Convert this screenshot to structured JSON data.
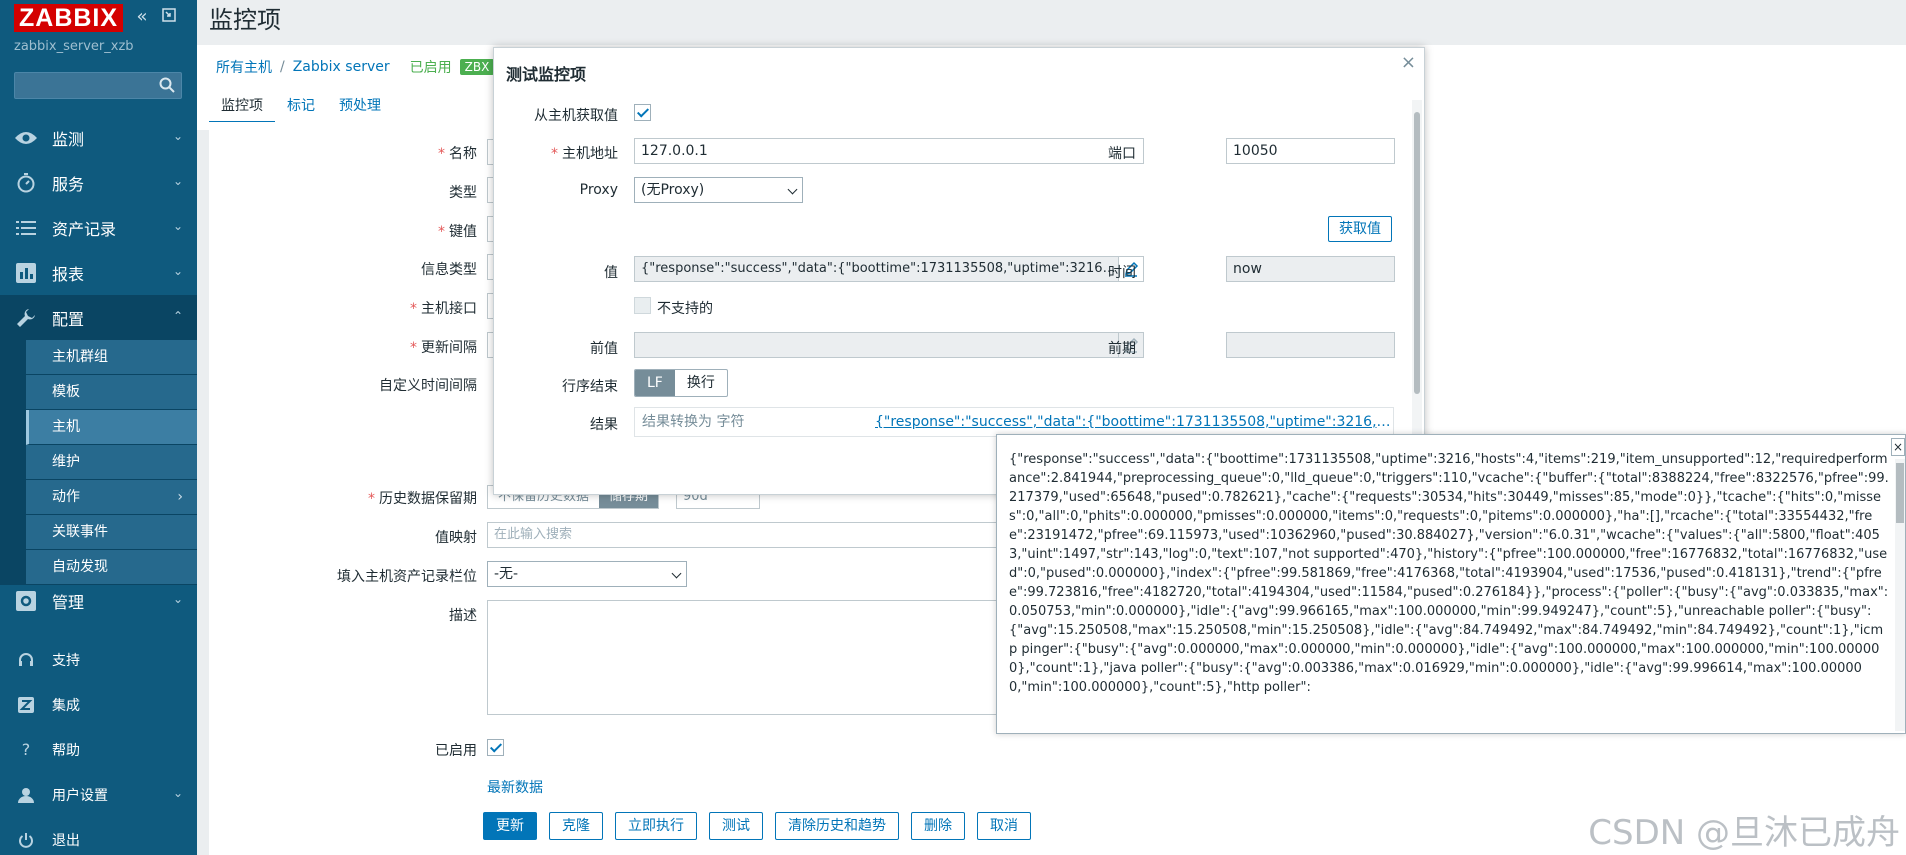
{
  "sidebar": {
    "logo": "ZABBIX",
    "server_name": "zabbix_server_xzb",
    "search_placeholder": "",
    "menu": [
      {
        "label": "监测"
      },
      {
        "label": "服务"
      },
      {
        "label": "资产记录"
      },
      {
        "label": "报表"
      },
      {
        "label": "配置"
      }
    ],
    "submenu": [
      {
        "label": "主机群组"
      },
      {
        "label": "模板"
      },
      {
        "label": "主机"
      },
      {
        "label": "维护"
      },
      {
        "label": "动作"
      },
      {
        "label": "关联事件"
      },
      {
        "label": "自动发现"
      }
    ],
    "admin": {
      "label": "管理"
    },
    "bottom": [
      {
        "label": "支持"
      },
      {
        "label": "集成"
      },
      {
        "label": "帮助"
      },
      {
        "label": "用户设置"
      },
      {
        "label": "退出"
      }
    ]
  },
  "page": {
    "title": "监控项",
    "breadcrumb": {
      "all_hosts": "所有主机",
      "sep": "/",
      "host": "Zabbix server",
      "status": "已启用",
      "badge": "ZBX"
    },
    "tabs": [
      {
        "label": "监控项"
      },
      {
        "label": "标记"
      },
      {
        "label": "预处理"
      }
    ]
  },
  "form": {
    "labels": {
      "name": "名称",
      "type": "类型",
      "key": "键值",
      "info_type": "信息类型",
      "interface": "主机接口",
      "interval": "更新间隔",
      "custom_interval": "自定义时间间隔",
      "history": "历史数据保留期",
      "valuemap": "值映射",
      "inventory": "填入主机资产记录栏位",
      "description": "描述",
      "enabled": "已启用"
    },
    "history": {
      "option1": "不保留历史数据",
      "option2": "储存期",
      "value": "90d"
    },
    "valuemap_placeholder": "在此输入搜索",
    "inventory_value": "-无-",
    "latest_data": "最新数据",
    "buttons": {
      "update": "更新",
      "clone": "克隆",
      "execute_now": "立即执行",
      "test": "测试",
      "clear": "清除历史和趋势",
      "delete": "删除",
      "cancel": "取消"
    }
  },
  "dialog": {
    "title": "测试监控项",
    "close": "×",
    "get_from_host_label": "从主机获取值",
    "host_address_label": "主机地址",
    "host_address": "127.0.0.1",
    "port_label": "端口",
    "port": "10050",
    "proxy_label": "Proxy",
    "proxy_value": "(无Proxy)",
    "get_value_button": "获取值",
    "value_label": "值",
    "value": "{\"response\":\"success\",\"data\":{\"boottime\":1731135508,\"uptime\":3216,\"hosts\":4,\"items\":219,",
    "time_label": "时间",
    "time_value": "now",
    "not_supported_label": "不支持的",
    "prev_value_label": "前值",
    "prev_time_label": "前期",
    "eol_label": "行序结束",
    "eol_lf": "LF",
    "eol_crlf": "换行",
    "result_label": "结果",
    "result_type": "结果转换为 字符",
    "result_value": "{\"response\":\"success\",\"data\":{\"boottime\":1731135508,\"uptime\":3216,\"hosts\":4,\"items\":219,"
  },
  "hintbox": {
    "close": "×",
    "text": "{\"response\":\"success\",\"data\":{\"boottime\":1731135508,\"uptime\":3216,\"hosts\":4,\"items\":219,\"item_unsupported\":12,\"requiredperformance\":2.841944,\"preprocessing_queue\":0,\"lld_queue\":0,\"triggers\":110,\"vcache\":{\"buffer\":{\"total\":8388224,\"free\":8322576,\"pfree\":99.217379,\"used\":65648,\"pused\":0.782621},\"cache\":{\"requests\":30534,\"hits\":30449,\"misses\":85,\"mode\":0}},\"tcache\":{\"hits\":0,\"misses\":0,\"all\":0,\"phits\":0.000000,\"pmisses\":0.000000,\"items\":0,\"requests\":0,\"pitems\":0.000000},\"ha\":[],\"rcache\":{\"total\":33554432,\"free\":23191472,\"pfree\":69.115973,\"used\":10362960,\"pused\":30.884027},\"version\":\"6.0.31\",\"wcache\":{\"values\":{\"all\":5800,\"float\":4053,\"uint\":1497,\"str\":143,\"log\":0,\"text\":107,\"not supported\":470},\"history\":{\"pfree\":100.000000,\"free\":16776832,\"total\":16776832,\"used\":0,\"pused\":0.000000},\"index\":{\"pfree\":99.581869,\"free\":4176368,\"total\":4193904,\"used\":17536,\"pused\":0.418131},\"trend\":{\"pfree\":99.723816,\"free\":4182720,\"total\":4194304,\"used\":11584,\"pused\":0.276184}},\"process\":{\"poller\":{\"busy\":{\"avg\":0.033835,\"max\":0.050753,\"min\":0.000000},\"idle\":{\"avg\":99.966165,\"max\":100.000000,\"min\":99.949247},\"count\":5},\"unreachable poller\":{\"busy\":{\"avg\":15.250508,\"max\":15.250508,\"min\":15.250508},\"idle\":{\"avg\":84.749492,\"max\":84.749492,\"min\":84.749492},\"count\":1},\"icmp pinger\":{\"busy\":{\"avg\":0.000000,\"max\":0.000000,\"min\":0.000000},\"idle\":{\"avg\":100.000000,\"max\":100.000000,\"min\":100.000000},\"count\":1},\"java poller\":{\"busy\":{\"avg\":0.003386,\"max\":0.016929,\"min\":0.000000},\"idle\":{\"avg\":99.996614,\"max\":100.000000,\"min\":100.000000},\"count\":5},\"http poller\":"
  },
  "watermark": "CSDN @旦沐已成舟"
}
